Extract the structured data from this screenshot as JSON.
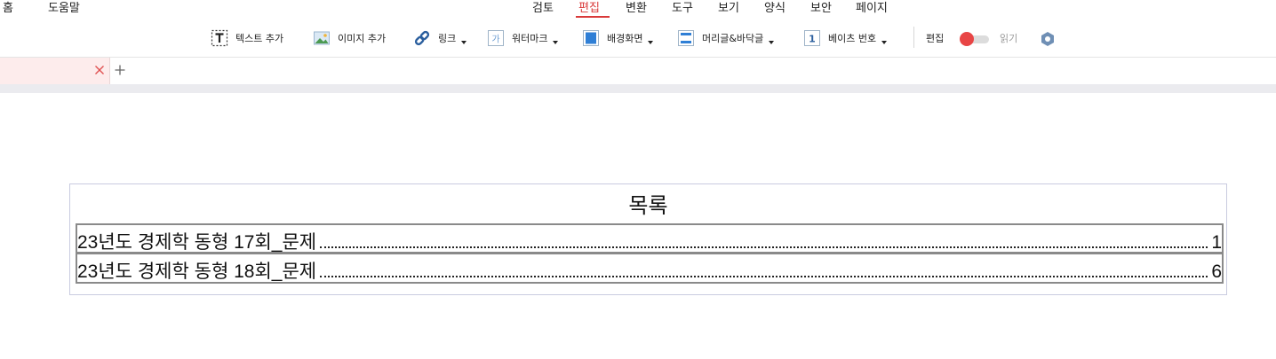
{
  "menu": {
    "left_items": [
      "홈",
      "도움말"
    ],
    "center_items": [
      "검토",
      "편집",
      "변환",
      "도구",
      "보기",
      "양식",
      "보안",
      "페이지"
    ],
    "active": "편집"
  },
  "toolbar": {
    "add_text": "텍스트 추가",
    "add_image": "이미지 추가",
    "link": "링크",
    "watermark": "워터마크",
    "background": "배경화면",
    "header_footer": "머리글&바닥글",
    "bates": "베이츠 번호",
    "edit_label": "편집",
    "read_label": "읽기",
    "icons": {
      "text": "text-box-icon",
      "image": "image-icon",
      "link": "link-icon",
      "watermark": "watermark-icon",
      "background": "background-icon",
      "header_footer": "header-footer-icon",
      "bates": "bates-number-icon",
      "settings": "hexagon-settings-icon"
    },
    "bates_glyph": "1",
    "watermark_glyph": "가"
  },
  "tabs": {
    "close_glyph": "×",
    "add_glyph": "+"
  },
  "document": {
    "toc_title": "목록",
    "entries": [
      {
        "title": "23년도 경제학 동형 17회_문제",
        "page": "1"
      },
      {
        "title": "23년도 경제학 동형 18회_문제",
        "page": "6"
      }
    ]
  },
  "colors": {
    "accent": "#d93a3a",
    "toggle_knob": "#e84545",
    "icon_blue": "#2f7fd6",
    "tab_bg": "#fdecec"
  }
}
